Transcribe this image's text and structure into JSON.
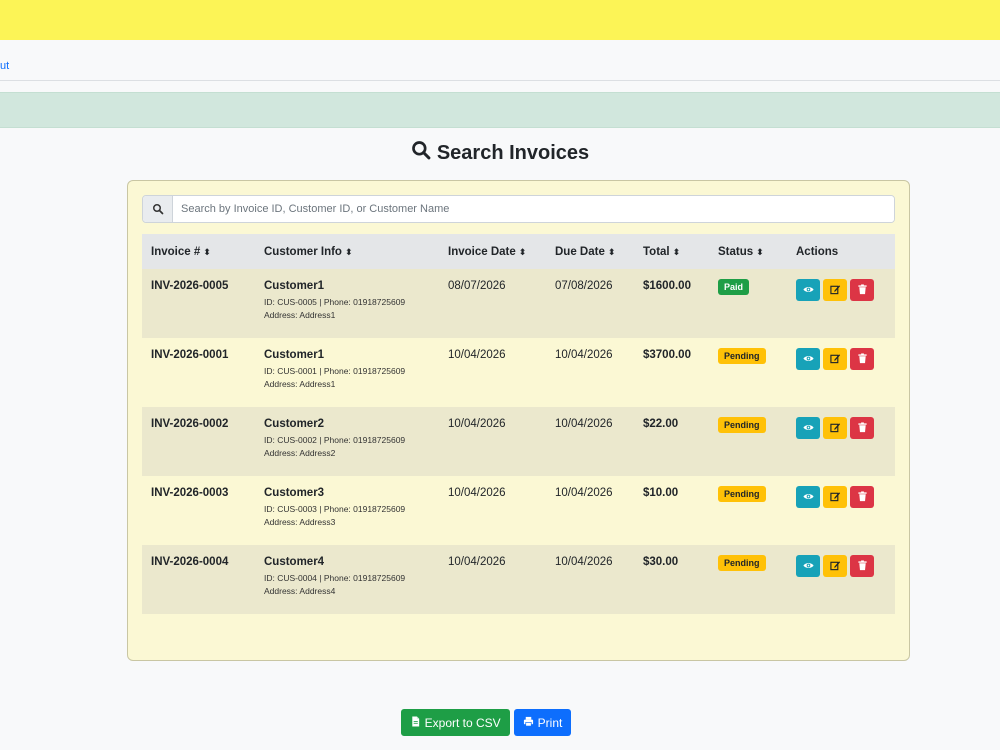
{
  "nav": {
    "link_text": "ut"
  },
  "page": {
    "title": "Search Invoices"
  },
  "search": {
    "placeholder": "Search by Invoice ID, Customer ID, or Customer Name"
  },
  "table": {
    "headers": [
      "Invoice #",
      "Customer Info",
      "Invoice Date",
      "Due Date",
      "Total",
      "Status",
      "Actions"
    ],
    "sort_glyph": "⬍",
    "rows": [
      {
        "invoice": "INV-2026-0005",
        "customer": "Customer1",
        "meta1": "ID: CUS-0005 | Phone: 01918725609",
        "meta2": "Address: Address1",
        "invoice_date": "08/07/2026",
        "due_date": "07/08/2026",
        "total": "$1600.00",
        "status": "Paid"
      },
      {
        "invoice": "INV-2026-0001",
        "customer": "Customer1",
        "meta1": "ID: CUS-0001 | Phone: 01918725609",
        "meta2": "Address: Address1",
        "invoice_date": "10/04/2026",
        "due_date": "10/04/2026",
        "total": "$3700.00",
        "status": "Pending"
      },
      {
        "invoice": "INV-2026-0002",
        "customer": "Customer2",
        "meta1": "ID: CUS-0002 | Phone: 01918725609",
        "meta2": "Address: Address2",
        "invoice_date": "10/04/2026",
        "due_date": "10/04/2026",
        "total": "$22.00",
        "status": "Pending"
      },
      {
        "invoice": "INV-2026-0003",
        "customer": "Customer3",
        "meta1": "ID: CUS-0003 | Phone: 01918725609",
        "meta2": "Address: Address3",
        "invoice_date": "10/04/2026",
        "due_date": "10/04/2026",
        "total": "$10.00",
        "status": "Pending"
      },
      {
        "invoice": "INV-2026-0004",
        "customer": "Customer4",
        "meta1": "ID: CUS-0004 | Phone: 01918725609",
        "meta2": "Address: Address4",
        "invoice_date": "10/04/2026",
        "due_date": "10/04/2026",
        "total": "$30.00",
        "status": "Pending"
      }
    ]
  },
  "footer": {
    "export_label": "Export to CSV",
    "print_label": "Print"
  },
  "colors": {
    "top_banner": "#fcf456",
    "alert_bar": "#d1e7dd",
    "card_bg": "#fbf8d4",
    "paid": "#1e9e46",
    "pending": "#ffc107",
    "view": "#17a2b8",
    "edit": "#ffc107",
    "delete": "#dc3545",
    "print": "#0d6efd"
  },
  "icons": {
    "title": "search-icon",
    "search_addon": "search-icon",
    "view": "eye-icon",
    "edit": "edit-icon",
    "delete": "trash-icon",
    "export": "file-icon",
    "print": "print-icon"
  }
}
